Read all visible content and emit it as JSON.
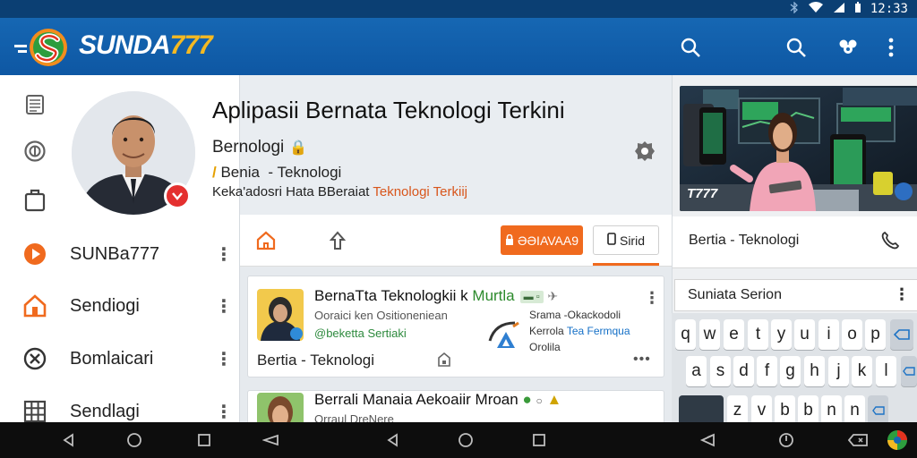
{
  "status_bar": {
    "time": "12:33"
  },
  "app_bar": {
    "brand_text": "SUNDA",
    "brand_num": "777",
    "icons": [
      "search-icon",
      "search-icon",
      "people-icon",
      "more-vert-icon"
    ]
  },
  "profile": {
    "title": "Aplipasii Bernata Teknologi Terkini",
    "subtitle": "Bernologi",
    "category_prefix": "Benia",
    "category_name": "- Teknologi",
    "tagline_main": "Keka'adosri Hata BBeraiat",
    "tagline_highlight": "Teknologi Terkiij"
  },
  "sidebar": {
    "rail_icons": [
      "document-icon",
      "coin-icon",
      "shopping-bag-icon"
    ],
    "items": [
      {
        "label": "SUNBa777",
        "icon": "play-icon"
      },
      {
        "label": "Sendiogi",
        "icon": "home-icon"
      },
      {
        "label": "Bomlaicari",
        "icon": "block-icon"
      },
      {
        "label": "Sendlagi",
        "icon": "grid-icon"
      }
    ]
  },
  "toolbar": {
    "orange_button": "ƏƏIAVAA9",
    "white_button": "Sirid"
  },
  "feed": {
    "cards": [
      {
        "title": "BernaTta Teknologkii k",
        "title_green": "Murtla",
        "tag": "▬ ▫",
        "line1": "Ooraici ken Ositioneniean",
        "line2": "@beketta Sertiaki",
        "right1": "Srama -Okackodoli",
        "right2_a": "Kerrola",
        "right2_b": "Tea Fermqua",
        "right3": "Orolila",
        "footer": "Bertia - Teknologi",
        "dots": "•••"
      },
      {
        "title": "Berrali Manaia Aekoaiir Mroan",
        "line1": "Orraul DreNere"
      }
    ]
  },
  "right_panel": {
    "hero_badge": "T777",
    "caption": "Bertia - Teknologi",
    "section_label": "Suniata Serion"
  },
  "keyboard": {
    "row1": [
      "q",
      "w",
      "e",
      "t",
      "y",
      "u",
      "i",
      "o",
      "p"
    ],
    "row2": [
      "a",
      "s",
      "d",
      "f",
      "g",
      "h",
      "j",
      "k",
      "l"
    ],
    "row3": [
      "z",
      "v",
      "b",
      "b",
      "n",
      "n"
    ]
  },
  "colors": {
    "app_bar": "#1667b3",
    "accent_orange": "#f06a1e",
    "brand_gold": "#f4b922",
    "nav_bar": "#0d0d0d"
  }
}
